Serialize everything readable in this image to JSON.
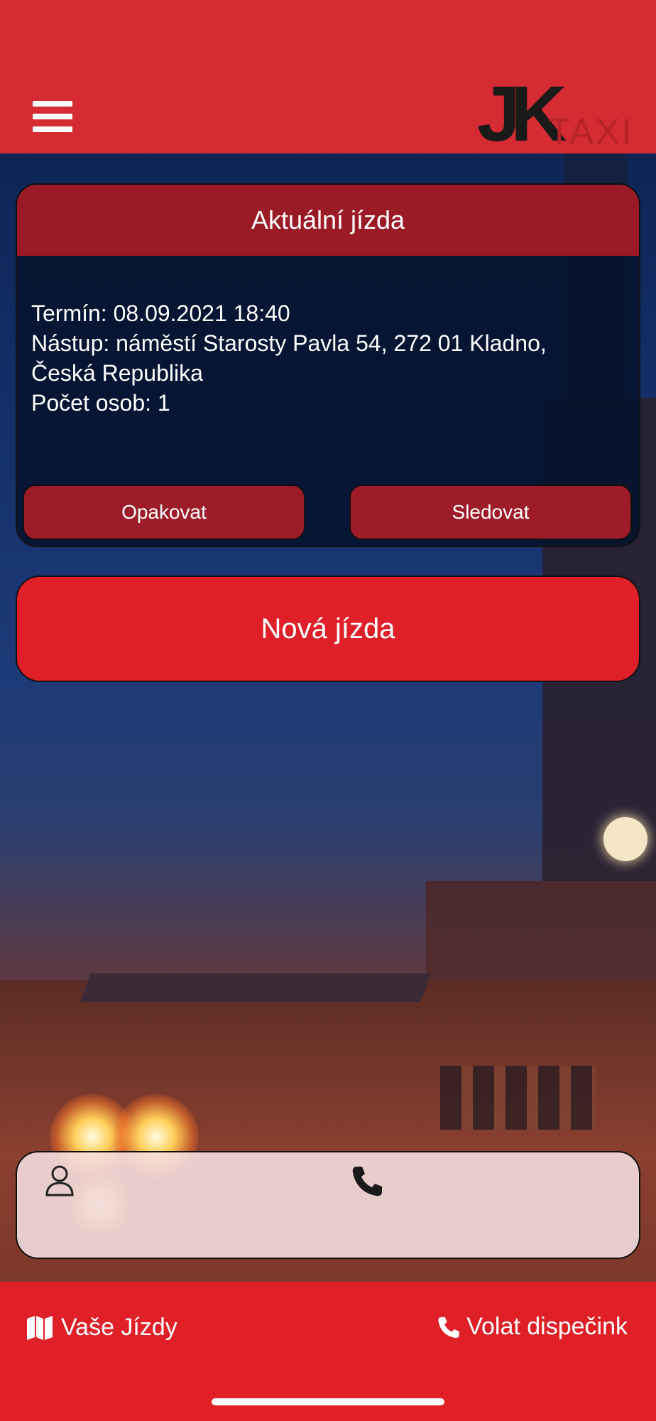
{
  "header": {
    "menu_icon": "hamburger-menu-icon",
    "logo_text": "JK",
    "logo_subtext": "TAXI"
  },
  "current_ride": {
    "title": "Aktuální jízda",
    "term": "Termín: 08.09.2021 18:40",
    "pickup_line1": "Nástup: náměstí Starosty Pavla 54, 272 01 Kladno,",
    "pickup_line2": "Česká Republika",
    "passengers": "Počet osob: 1",
    "repeat_label": "Opakovat",
    "track_label": "Sledovat"
  },
  "new_ride_label": "Nová jízda",
  "profile": {
    "user_icon": "user-icon",
    "phone_icon": "phone-icon",
    "name": "",
    "phone": ""
  },
  "bottom_nav": {
    "rides_label": "Vaše Jízdy",
    "rides_icon": "map-icon",
    "call_label": "Volat dispečink",
    "call_icon": "phone-icon"
  },
  "colors": {
    "brand_red": "#e01f27",
    "header_red": "#d52b32",
    "card_red": "#9a1a26"
  }
}
